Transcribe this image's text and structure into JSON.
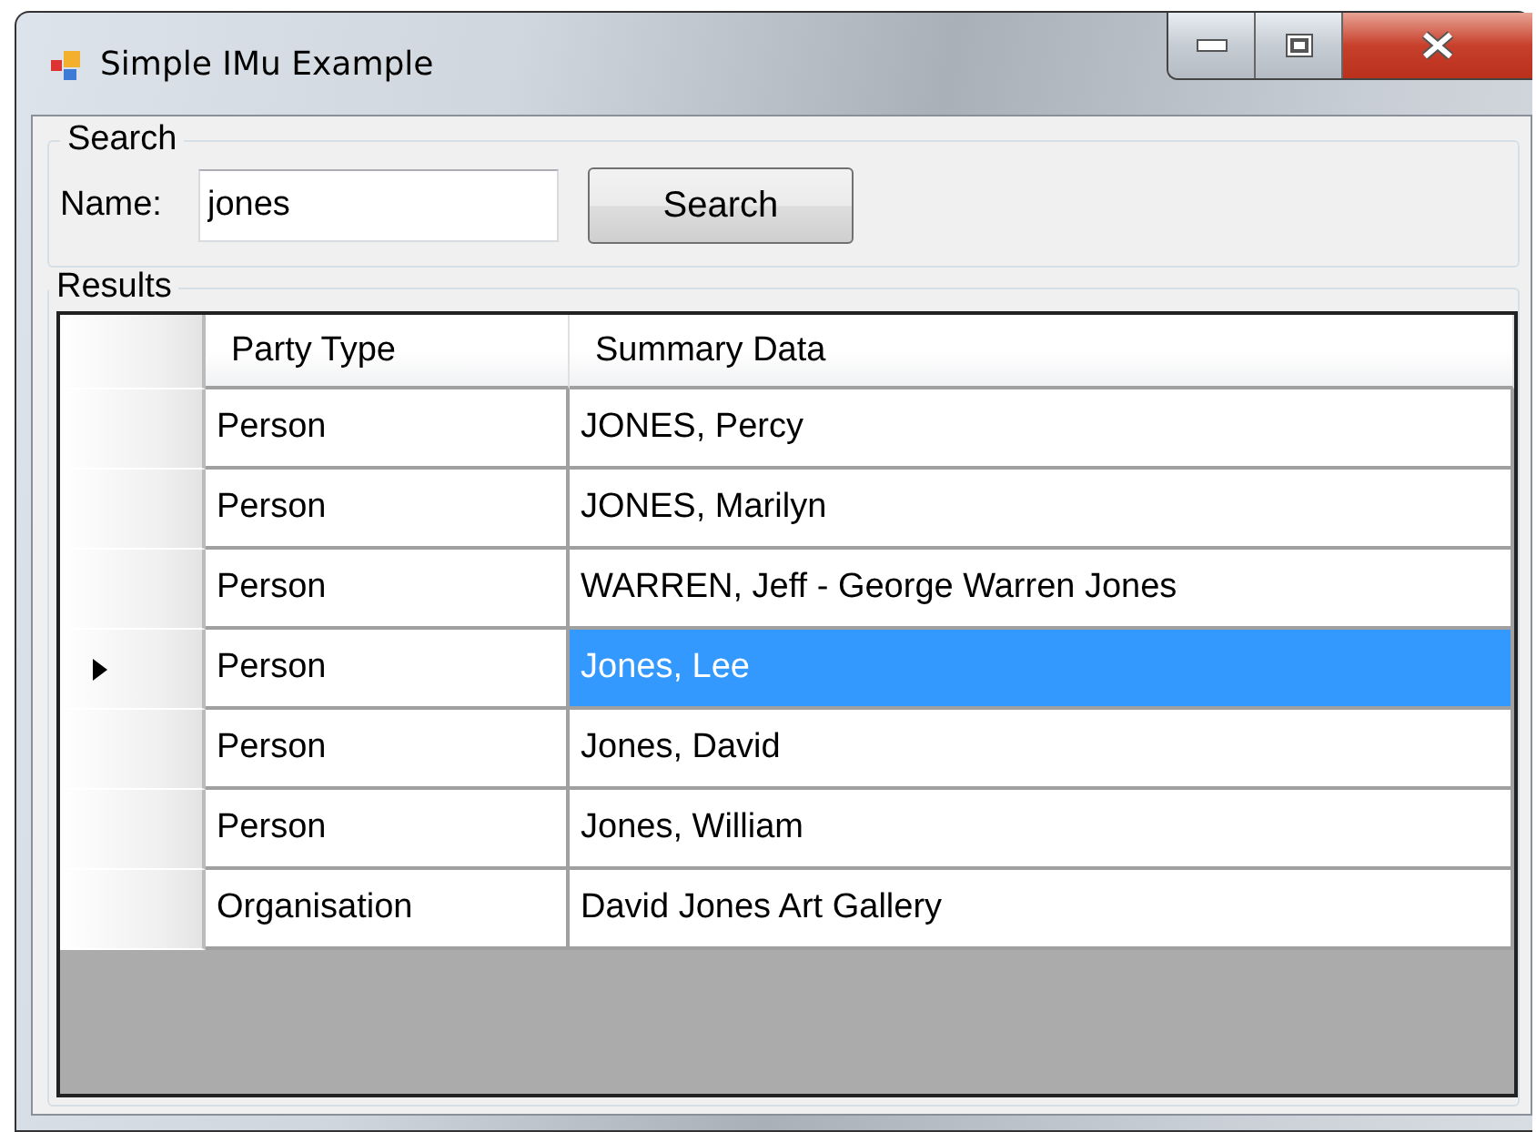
{
  "window": {
    "title": "Simple IMu Example"
  },
  "search_group": {
    "label": "Search",
    "name_label": "Name:",
    "name_value": "jones",
    "button": "Search"
  },
  "results_group": {
    "label": "Results"
  },
  "table": {
    "columns": [
      "Party Type",
      "Summary Data"
    ],
    "rows": [
      {
        "cells": [
          "Person",
          "JONES, Percy"
        ],
        "selected": false
      },
      {
        "cells": [
          "Person",
          "JONES, Marilyn"
        ],
        "selected": false
      },
      {
        "cells": [
          "Person",
          "WARREN, Jeff - George Warren Jones"
        ],
        "selected": false
      },
      {
        "cells": [
          "Person",
          "Jones, Lee"
        ],
        "selected": true
      },
      {
        "cells": [
          "Person",
          "Jones, David"
        ],
        "selected": false
      },
      {
        "cells": [
          "Person",
          "Jones, William"
        ],
        "selected": false
      },
      {
        "cells": [
          "Organisation",
          "David Jones Art Gallery"
        ],
        "selected": false
      }
    ]
  }
}
